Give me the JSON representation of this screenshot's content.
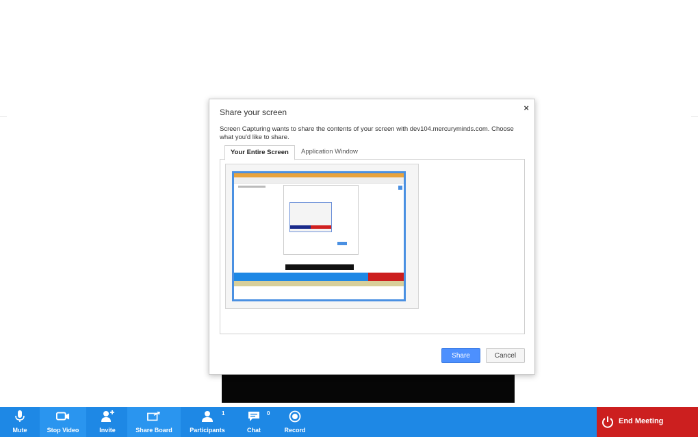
{
  "dialog": {
    "title": "Share your screen",
    "close_glyph": "×",
    "description": "Screen Capturing wants to share the contents of your screen with dev104.mercuryminds.com. Choose what you'd like to share.",
    "tabs": [
      {
        "label": "Your Entire Screen",
        "active": true
      },
      {
        "label": "Application Window",
        "active": false
      }
    ],
    "share_label": "Share",
    "cancel_label": "Cancel"
  },
  "toolbar": {
    "items": [
      {
        "label": "Mute",
        "icon": "microphone-icon"
      },
      {
        "label": "Stop Video",
        "icon": "video-camera-icon"
      },
      {
        "label": "Invite",
        "icon": "add-user-icon"
      },
      {
        "label": "Share Board",
        "icon": "share-board-icon"
      },
      {
        "label": "Participants",
        "icon": "participants-icon",
        "count": "1"
      },
      {
        "label": "Chat",
        "icon": "chat-bubble-icon",
        "count": "0"
      },
      {
        "label": "Record",
        "icon": "record-icon"
      }
    ],
    "end_meeting_label": "End Meeting"
  },
  "colors": {
    "toolbar": "#1e88e5",
    "end_meeting": "#cc1f1f",
    "share_button": "#4d90fe",
    "selection_border": "#4a90e2"
  }
}
